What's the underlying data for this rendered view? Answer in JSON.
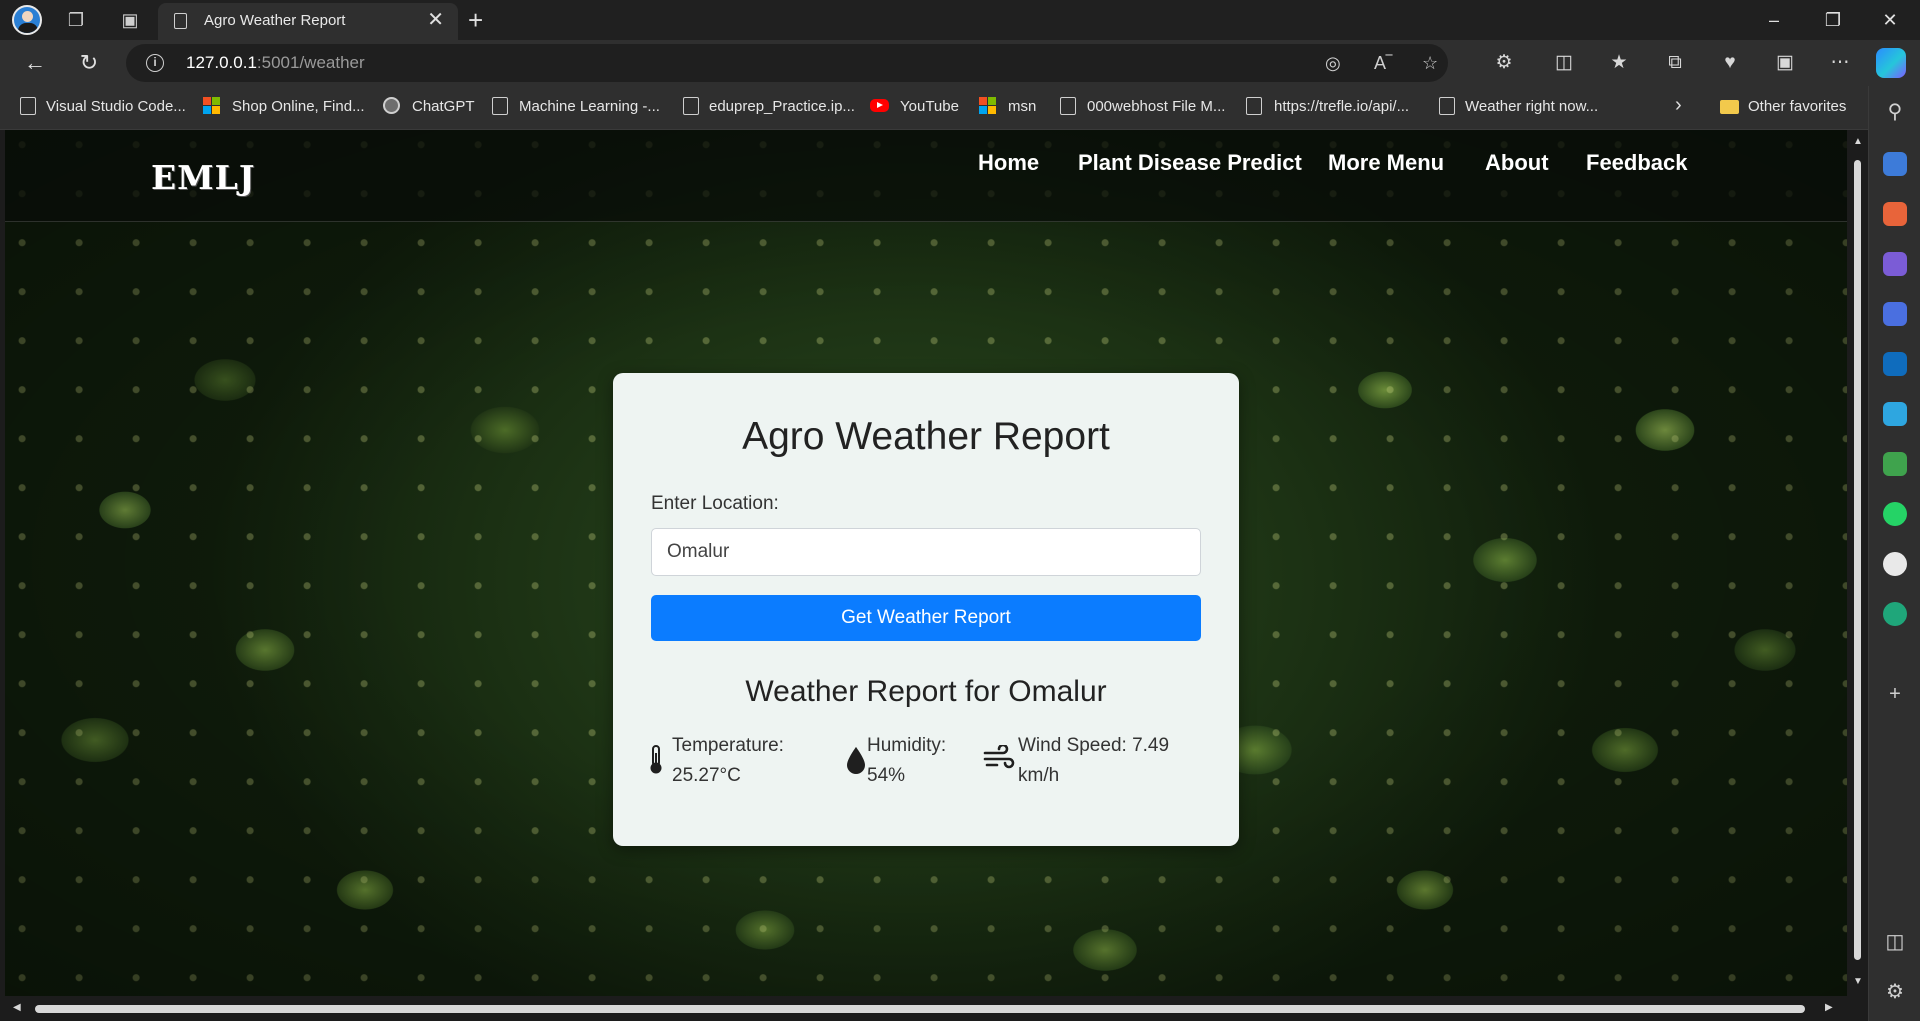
{
  "browser": {
    "tab_title": "Agro Weather Report",
    "url_host": "127.0.0.1",
    "url_rest": ":5001/weather",
    "bookmarks": [
      "Visual Studio Code...",
      "Shop Online, Find...",
      "ChatGPT",
      "Machine Learning -...",
      "eduprep_Practice.ip...",
      "YouTube",
      "msn",
      "000webhost File M...",
      "https://trefle.io/api/...",
      "Weather right now..."
    ],
    "other_favorites": "Other favorites"
  },
  "site": {
    "logo": "EMLJ",
    "nav": [
      "Home",
      "Plant Disease Predict",
      "More Menu",
      "About",
      "Feedback"
    ]
  },
  "card": {
    "title": "Agro Weather Report",
    "location_label": "Enter Location:",
    "location_value": "Omalur",
    "button_label": "Get Weather Report",
    "report_title": "Weather Report for Omalur",
    "temperature_label": "Temperature:",
    "temperature_value": "25.27°C",
    "humidity_label": "Humidity:",
    "humidity_value": "54%",
    "wind_label": "Wind Speed: 7.49",
    "wind_value": "km/h"
  }
}
